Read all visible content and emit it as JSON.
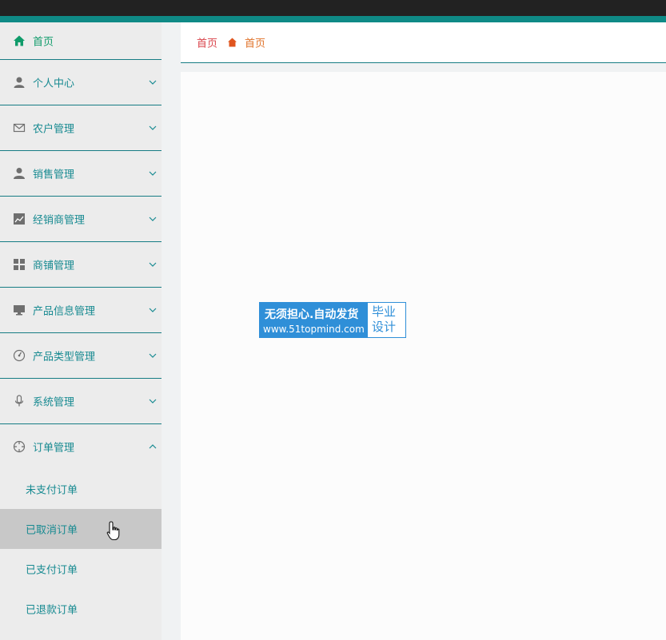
{
  "sidebar": {
    "items": [
      {
        "label": "首页",
        "icon": "home-icon"
      },
      {
        "label": "个人中心",
        "icon": "user-icon"
      },
      {
        "label": "农户管理",
        "icon": "mail-icon"
      },
      {
        "label": "销售管理",
        "icon": "person-icon"
      },
      {
        "label": "经销商管理",
        "icon": "chart-icon"
      },
      {
        "label": "商铺管理",
        "icon": "grid-icon"
      },
      {
        "label": "产品信息管理",
        "icon": "monitor-icon"
      },
      {
        "label": "产品类型管理",
        "icon": "gauge-icon"
      },
      {
        "label": "系统管理",
        "icon": "microphone-icon"
      },
      {
        "label": "订单管理",
        "icon": "crosshair-icon"
      }
    ],
    "order_submenu": [
      {
        "label": "未支付订单"
      },
      {
        "label": "已取消订单"
      },
      {
        "label": "已支付订单"
      },
      {
        "label": "已退款订单"
      }
    ]
  },
  "breadcrumb": {
    "first": "首页",
    "second": "首页"
  },
  "watermark": {
    "line1": "无须担心.自动发货",
    "line2": "www.51topmind.com",
    "right_top": "毕业",
    "right_bottom": "设计"
  },
  "colors": {
    "accent": "#0f8a86",
    "menu_text": "#178a91",
    "active_text": "#0f9b6a",
    "breadcrumb_first": "#d9434a",
    "breadcrumb_second": "#e0732a"
  }
}
